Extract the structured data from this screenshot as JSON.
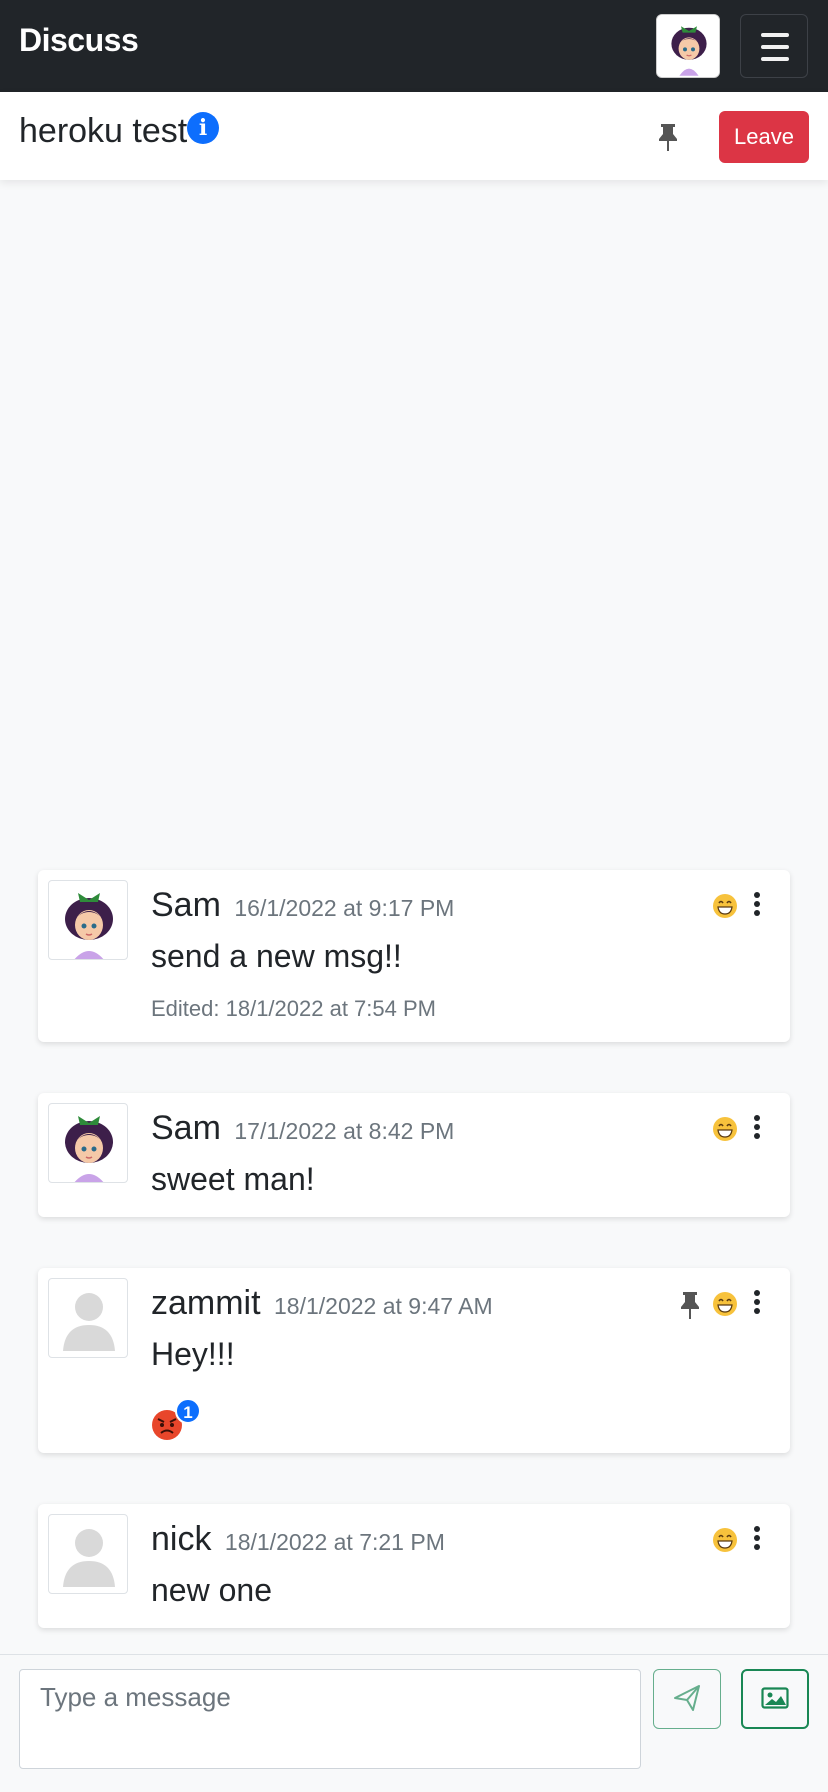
{
  "app": {
    "brand": "Discuss"
  },
  "navbar": {
    "avatar_icon": "avatar-girl-icon",
    "menu_icon": "hamburger-icon"
  },
  "room": {
    "title": "heroku test",
    "info_icon": "info-icon",
    "pin_icon": "pin-icon",
    "leave_label": "Leave"
  },
  "messages": [
    {
      "user": "Sam",
      "time": "16/1/2022 at 9:17 PM",
      "text": "send a new msg!!",
      "edited": "Edited: 18/1/2022 at 7:54 PM",
      "avatar": "girl-avatar",
      "pinned": false
    },
    {
      "user": "Sam",
      "time": "17/1/2022 at 8:42 PM",
      "text": "sweet man!",
      "avatar": "girl-avatar",
      "pinned": false
    },
    {
      "user": "zammit",
      "time": "18/1/2022 at 9:47 AM",
      "text": "Hey!!!",
      "avatar": "default-avatar",
      "pinned": true,
      "reaction": {
        "emoji": "angry-face",
        "count": "1"
      }
    },
    {
      "user": "nick",
      "time": "18/1/2022 at 7:21 PM",
      "text": "new one",
      "avatar": "default-avatar",
      "pinned": false
    }
  ],
  "composer": {
    "placeholder": "Type a message",
    "send_icon": "send-icon",
    "image_icon": "image-icon"
  },
  "colors": {
    "navbar": "#212529",
    "leave": "#dc3545",
    "info": "#0d6efd",
    "send": "#198754"
  }
}
